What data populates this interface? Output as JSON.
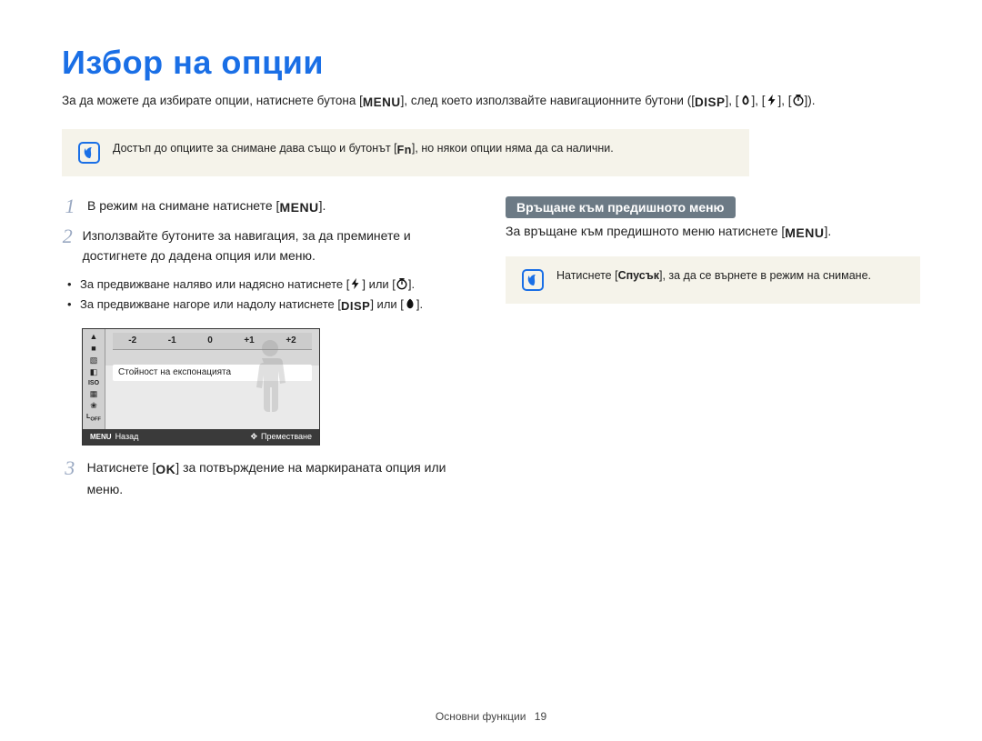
{
  "title": "Избор на опции",
  "intro": {
    "before_menu": "За да можете да избирате опции, натиснете бутона [",
    "menu": "MENU",
    "after_menu": "], след което използвайте навигационните бутони ([",
    "disp": "DISP",
    "sep1": "], [",
    "sep2": "], [",
    "sep3": "], [",
    "end": "])."
  },
  "tip1": {
    "before_fn": "Достъп до опциите за снимане дава също и бутонът [",
    "fn": "Fn",
    "after_fn": "], но някои опции няма да са налични."
  },
  "steps": {
    "s1_num": "1",
    "s1_before": "В режим на снимане натиснете [",
    "s1_menu": "MENU",
    "s1_after": "].",
    "s2_num": "2",
    "s2_text": "Използвайте бутоните за навигация, за да преминете и достигнете до дадена опция или меню.",
    "s2_b1_before": "За предвижване наляво или надясно натиснете [",
    "s2_b1_mid": "] или [",
    "s2_b1_after": "].",
    "s2_b2_before": "За предвижване нагоре или надолу натиснете [",
    "s2_b2_disp": "DISP",
    "s2_b2_mid": "] или [",
    "s2_b2_after": "].",
    "s3_num": "3",
    "s3_before": "Натиснете [",
    "s3_ok": "OK",
    "s3_after": "] за потвърждение на маркираната опция или меню."
  },
  "lcd": {
    "ev_ticks": [
      "-2",
      "-1",
      "0",
      "+1",
      "+2"
    ],
    "highlight": "Стойност на експонацията",
    "foot_left_label": "MENU",
    "foot_left_text": "Назад",
    "foot_right_text": "Преместване"
  },
  "right": {
    "pill": "Връщане към предишното меню",
    "text_before": "За връщане към предишното меню натиснете [",
    "text_menu": "MENU",
    "text_after": "].",
    "tip_before": "Натиснете [",
    "tip_bold": "Спусък",
    "tip_after": "], за да се върнете в режим на снимане."
  },
  "footer": {
    "section": "Основни функции",
    "page": "19"
  }
}
